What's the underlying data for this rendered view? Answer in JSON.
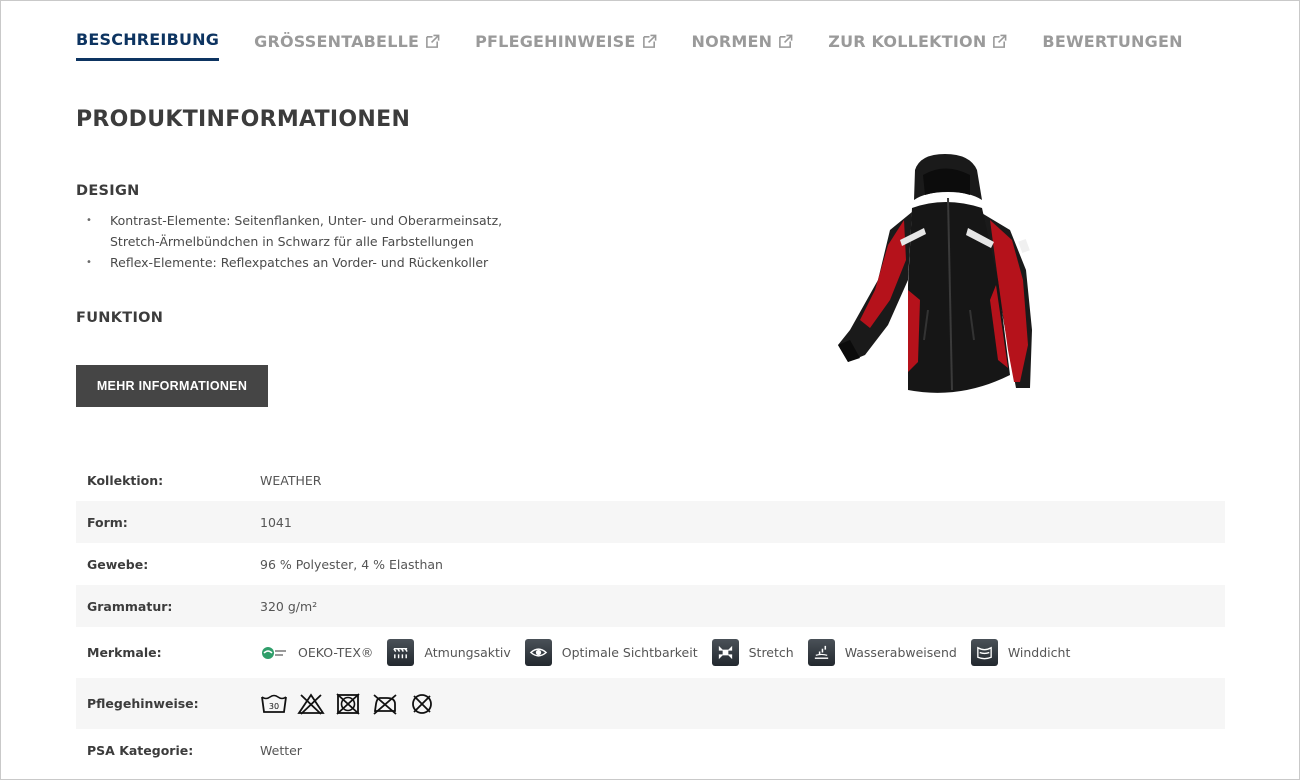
{
  "tabs": [
    {
      "label": "BESCHREIBUNG",
      "active": true,
      "external": false
    },
    {
      "label": "GRÖSSENTABELLE",
      "active": false,
      "external": true
    },
    {
      "label": "PFLEGEHINWEISE",
      "active": false,
      "external": true
    },
    {
      "label": "NORMEN",
      "active": false,
      "external": true
    },
    {
      "label": "ZUR KOLLEKTION",
      "active": false,
      "external": true
    },
    {
      "label": "BEWERTUNGEN",
      "active": false,
      "external": false
    }
  ],
  "main": {
    "heading": "PRODUKTINFORMATIONEN",
    "design_title": "DESIGN",
    "design_bullets": [
      "Kontrast-Elemente: Seitenflanken, Unter- und Oberarmeinsatz, Stretch-Ärmelbündchen in Schwarz für alle Farbstellungen",
      "Reflex-Elemente: Reflexpatches an Vorder- und Rückenkoller"
    ],
    "funktion_title": "FUNKTION",
    "more_button": "MEHR INFORMATIONEN"
  },
  "specs": {
    "kollektion_label": "Kollektion:",
    "kollektion_value": "WEATHER",
    "form_label": "Form:",
    "form_value": "1041",
    "gewebe_label": "Gewebe:",
    "gewebe_value": "96 % Polyester, 4 % Elasthan",
    "grammatur_label": "Grammatur:",
    "grammatur_value": "320 g/m²",
    "merkmale_label": "Merkmale:",
    "merkmale": [
      {
        "label": "OEKO-TEX®",
        "icon": "oeko-tex-icon"
      },
      {
        "label": "Atmungsaktiv",
        "icon": "breathable-icon"
      },
      {
        "label": "Optimale Sichtbarkeit",
        "icon": "visibility-eye-icon"
      },
      {
        "label": "Stretch",
        "icon": "stretch-icon"
      },
      {
        "label": "Wasserabweisend",
        "icon": "water-repellent-icon"
      },
      {
        "label": "Winddicht",
        "icon": "windproof-icon"
      }
    ],
    "pflege_label": "Pflegehinweise:",
    "pflege_wash_temp": "30",
    "psa_label": "PSA Kategorie:",
    "psa_value": "Wetter"
  },
  "colors": {
    "active_tab": "#0d3461",
    "inactive_tab": "#9a9a9a",
    "button_bg": "#454545",
    "jacket_black": "#1a1a1a",
    "jacket_red": "#b5121b"
  }
}
